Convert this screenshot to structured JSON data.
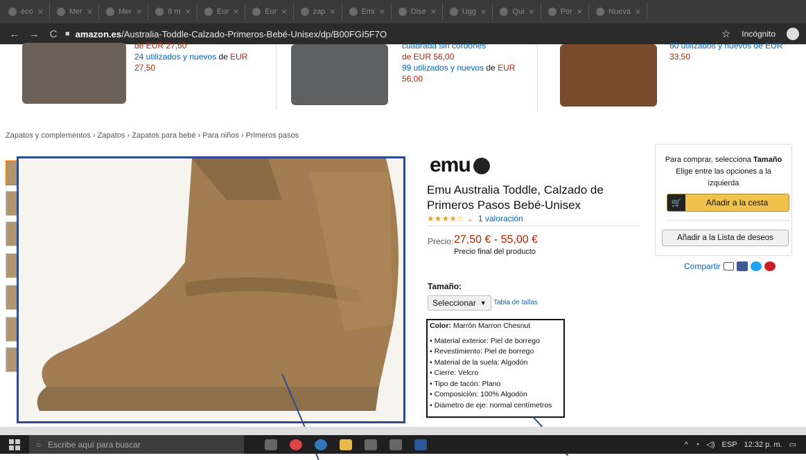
{
  "browser": {
    "tabs": [
      "eco",
      "Mer",
      "Mer",
      "8 m",
      "Eur",
      "Eur",
      "zap",
      "Emi",
      "Dise",
      "Ugg",
      "Qui",
      "Por",
      "Nueva"
    ],
    "url_host": "amazon.es",
    "url_path": "/Australia-Toddle-Calzado-Primeros-Bebé-Unisex/dp/B00FGI5F7O",
    "incognito_label": "Incógnito"
  },
  "carousel": [
    {
      "line1": "de EUR 27,50",
      "line2": "24 utilizados y nuevos",
      "line2_suffix": " de ",
      "line2_price": "EUR",
      "line3": "27,50"
    },
    {
      "line0": "cuadrada sin cordones",
      "line1": "de EUR 56,00",
      "line2": "99 utilizados y nuevos",
      "line2_suffix": " de ",
      "line2_price": "EUR",
      "line3": "56,00"
    },
    {
      "line1": "60 utilizados y nuevos de EUR",
      "line3": "33,50"
    }
  ],
  "breadcrumb": "Zapatos y complementos › Zapatos › Zapatos para bebé › Para niños › Primeros pasos",
  "product": {
    "brand": "emu",
    "title": "Emu Australia Toddle, Calzado de Primeros Pasos Bebé-Unisex",
    "stars": "★★★★☆ ⌄",
    "ratings": "1 valoración",
    "price_label": "Precio:",
    "price_range": "27,50 € - 55,00 €",
    "price_note": "Precio final del producto",
    "size_label": "Tamaño:",
    "size_select": "Seleccionar",
    "size_chart": "Tabla de tallas",
    "color_label": "Color:",
    "color_value": "Marrón Marron Chesnut",
    "details": [
      "Material exterior: Piel de borrego",
      "Revestimiento: Piel de borrego",
      "Material de la suela: Algodón",
      "Cierre: Velcro",
      "Tipo de tacón: Plano",
      "Composición: 100% Algodón",
      "Diámetro de eje: normal centímetros"
    ]
  },
  "buybox": {
    "prompt_prefix": "Para comprar, selecciona",
    "prompt_bold": "Tamaño",
    "prompt_rest": "Elige entre las opciones a la izquierda",
    "add_to_cart": "Añadir a la cesta",
    "add_to_wishlist": "Añadir a la Lista de deseos",
    "share": "Compartir"
  },
  "taskbar": {
    "search_placeholder": "Escribe aquí para buscar",
    "lang": "ESP",
    "time": "12:32 p. m."
  },
  "colors": {
    "accent_price": "#b12704",
    "link": "#0066c0",
    "cart_button": "#f0c14b",
    "annotation_box": "#2e4a8c"
  }
}
